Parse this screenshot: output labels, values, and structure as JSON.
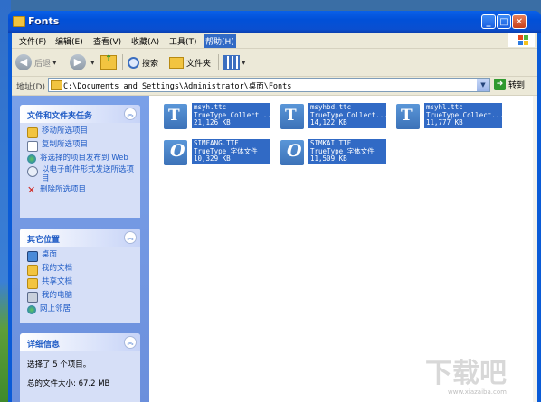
{
  "window": {
    "title": "Fonts"
  },
  "menu": [
    "文件(F)",
    "编辑(E)",
    "查看(V)",
    "收藏(A)",
    "工具(T)",
    "帮助(H)"
  ],
  "toolbar": {
    "back": "后退",
    "search": "搜索",
    "folders": "文件夹"
  },
  "address": {
    "label": "地址(D)",
    "path": "C:\\Documents and Settings\\Administrator\\桌面\\Fonts",
    "go": "转到"
  },
  "tasks": {
    "title": "文件和文件夹任务",
    "items": [
      "移动所选项目",
      "复制所选项目",
      "将选择的项目发布到 Web",
      "以电子邮件形式发送所选项目",
      "删除所选项目"
    ]
  },
  "places": {
    "title": "其它位置",
    "items": [
      "桌面",
      "我的文档",
      "共享文档",
      "我的电脑",
      "网上邻居"
    ]
  },
  "details": {
    "title": "详细信息",
    "selected": "选择了 5 个项目。",
    "total": "总的文件大小: 67.2 MB"
  },
  "files": [
    {
      "name": "msyh.ttc",
      "type": "TrueType Collect...",
      "size": "21,126 KB",
      "kind": "ttc"
    },
    {
      "name": "msyhbd.ttc",
      "type": "TrueType Collect...",
      "size": "14,122 KB",
      "kind": "ttc"
    },
    {
      "name": "msyhl.ttc",
      "type": "TrueType Collect...",
      "size": "11,777 KB",
      "kind": "ttc"
    },
    {
      "name": "SIMFANG.TTF",
      "type": "TrueType 字体文件",
      "size": "10,329 KB",
      "kind": "otf"
    },
    {
      "name": "SIMKAI.TTF",
      "type": "TrueType 字体文件",
      "size": "11,509 KB",
      "kind": "otf"
    }
  ],
  "watermark": {
    "text": "下载吧",
    "site": "www.xiazaiba.com"
  },
  "colors": {
    "titlebar": "#0a5bd7",
    "selection": "#316ac5",
    "taskpane": "#6b8fdc",
    "link": "#215dc6"
  }
}
